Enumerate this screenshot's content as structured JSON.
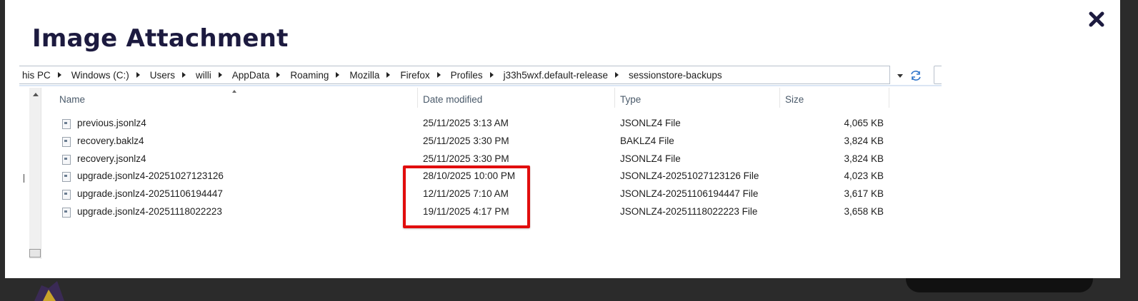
{
  "modal": {
    "title": "Image Attachment",
    "close_icon": "close-icon"
  },
  "explorer": {
    "breadcrumb": [
      "his PC",
      "Windows (C:)",
      "Users",
      "willi",
      "AppData",
      "Roaming",
      "Mozilla",
      "Firefox",
      "Profiles",
      "j33h5wxf.default-release",
      "sessionstore-backups"
    ],
    "columns": {
      "name": "Name",
      "date": "Date modified",
      "type": "Type",
      "size": "Size"
    },
    "files": [
      {
        "name": "previous.jsonlz4",
        "date": "25/11/2025 3:13 AM",
        "type": "JSONLZ4 File",
        "size": "4,065 KB"
      },
      {
        "name": "recovery.baklz4",
        "date": "25/11/2025 3:30 PM",
        "type": "BAKLZ4 File",
        "size": "3,824 KB"
      },
      {
        "name": "recovery.jsonlz4",
        "date": "25/11/2025 3:30 PM",
        "type": "JSONLZ4 File",
        "size": "3,824 KB"
      },
      {
        "name": "upgrade.jsonlz4-20251027123126",
        "date": "28/10/2025 10:00 PM",
        "type": "JSONLZ4-20251027123126 File",
        "size": "4,023 KB"
      },
      {
        "name": "upgrade.jsonlz4-20251106194447",
        "date": "12/11/2025 7:10 AM",
        "type": "JSONLZ4-20251106194447 File",
        "size": "3,617 KB"
      },
      {
        "name": "upgrade.jsonlz4-20251118022223",
        "date": "19/11/2025 4:17 PM",
        "type": "JSONLZ4-20251118022223 File",
        "size": "3,658 KB"
      }
    ],
    "highlight_color": "#e10d0d"
  }
}
